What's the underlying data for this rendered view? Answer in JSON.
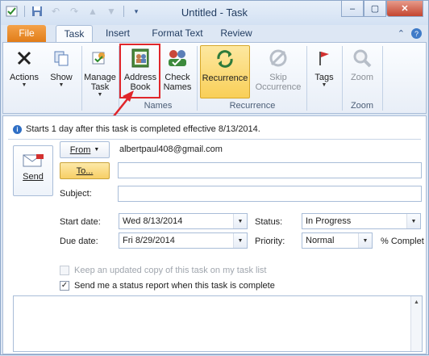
{
  "window": {
    "title": "Untitled - Task",
    "controls": {
      "minimize": "–",
      "maximize": "▢",
      "close": "✕"
    }
  },
  "qat": {
    "icons": [
      "app-task-icon",
      "save-icon",
      "undo-icon",
      "redo-icon",
      "up-icon",
      "down-icon",
      "customize-icon"
    ]
  },
  "tabs": [
    {
      "label": "File"
    },
    {
      "label": "Task"
    },
    {
      "label": "Insert"
    },
    {
      "label": "Format Text"
    },
    {
      "label": "Review"
    }
  ],
  "ribbon": {
    "actions": {
      "label": "Actions"
    },
    "show": {
      "label": "Show"
    },
    "manage_task": {
      "label": "Manage\nTask"
    },
    "address_book": {
      "label": "Address\nBook"
    },
    "check_names": {
      "label": "Check\nNames"
    },
    "recurrence": {
      "label": "Recurrence"
    },
    "skip_occurrence": {
      "label": "Skip\nOccurrence"
    },
    "tags": {
      "label": "Tags"
    },
    "zoom": {
      "label": "Zoom"
    },
    "groups": {
      "names": "Names",
      "recurrence": "Recurrence",
      "zoom": "Zoom"
    }
  },
  "info_bar": "Starts 1 day after this task is completed effective 8/13/2014.",
  "send": {
    "label": "Send"
  },
  "from": {
    "label": "From",
    "value": "albertpaul408@gmail.com"
  },
  "to": {
    "label": "To...",
    "value": ""
  },
  "subject": {
    "label": "Subject:",
    "value": ""
  },
  "start_date": {
    "label": "Start date:",
    "value": "Wed 8/13/2014"
  },
  "due_date": {
    "label": "Due date:",
    "value": "Fri 8/29/2014"
  },
  "status": {
    "label": "Status:",
    "value": "In Progress"
  },
  "priority": {
    "label": "Priority:",
    "value": "Normal"
  },
  "percent_complete": {
    "label": "% Complet"
  },
  "checks": {
    "keep_copy": {
      "label": "Keep an updated copy of this task on my task list",
      "checked": false,
      "enabled": false
    },
    "status_report": {
      "label": "Send me a status report when this task is complete",
      "checked": true,
      "enabled": true
    }
  },
  "colors": {
    "file_tab": "#e07b16",
    "highlight": "#e0262b",
    "selected": "#f9cf58"
  }
}
